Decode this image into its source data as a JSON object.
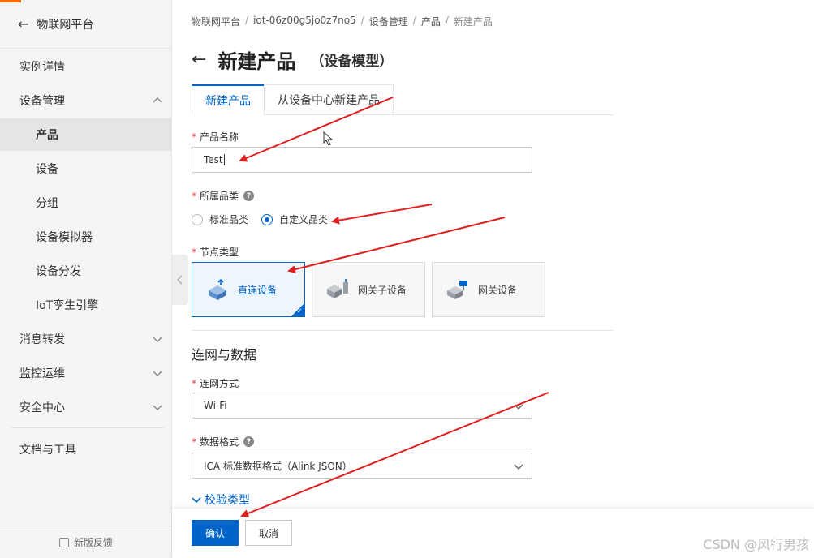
{
  "sidebar": {
    "title": "物联网平台",
    "items": [
      {
        "label": "实例详情"
      },
      {
        "label": "设备管理"
      },
      {
        "label": "产品"
      },
      {
        "label": "设备"
      },
      {
        "label": "分组"
      },
      {
        "label": "设备模拟器"
      },
      {
        "label": "设备分发"
      },
      {
        "label": "IoT孪生引擎"
      },
      {
        "label": "消息转发"
      },
      {
        "label": "监控运维"
      },
      {
        "label": "安全中心"
      },
      {
        "label": "文档与工具"
      }
    ],
    "feedback": "新版反馈"
  },
  "breadcrumb": [
    "物联网平台",
    "iot-06z00g5jo0z7no5",
    "设备管理",
    "产品",
    "新建产品"
  ],
  "page": {
    "title": "新建产品",
    "subtitle": "（设备模型）"
  },
  "tabs": [
    {
      "label": "新建产品"
    },
    {
      "label": "从设备中心新建产品"
    }
  ],
  "form": {
    "product_name_label": "产品名称",
    "product_name_value": "Test",
    "category_label": "所属品类",
    "category_options": [
      {
        "label": "标准品类",
        "selected": false
      },
      {
        "label": "自定义品类",
        "selected": true
      }
    ],
    "node_type_label": "节点类型",
    "node_types": [
      {
        "label": "直连设备",
        "selected": true
      },
      {
        "label": "网关子设备",
        "selected": false
      },
      {
        "label": "网关设备",
        "selected": false
      }
    ],
    "section_title": "连网与数据",
    "network_label": "连网方式",
    "network_value": "Wi-Fi",
    "data_format_label": "数据格式",
    "data_format_value": "ICA 标准数据格式（Alink JSON）",
    "check_type_link": "校验类型"
  },
  "footer": {
    "confirm": "确认",
    "cancel": "取消"
  },
  "watermark": "CSDN @风行男孩",
  "colors": {
    "primary": "#0064c8",
    "annotation": "#e02020",
    "accent": "#ff6a00"
  }
}
